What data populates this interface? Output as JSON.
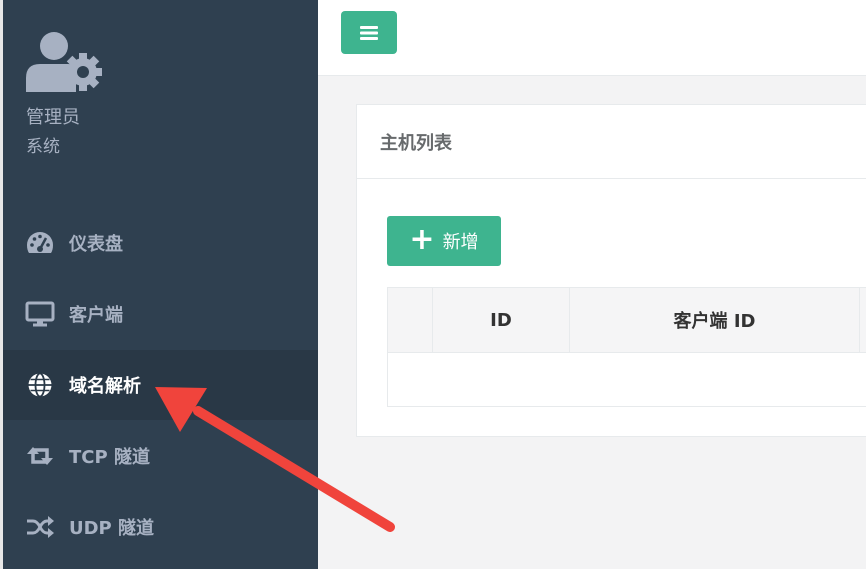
{
  "sidebar": {
    "user": {
      "name": "管理员",
      "role": "系统"
    },
    "items": [
      {
        "label": "仪表盘",
        "icon": "dashboard-icon",
        "active": false
      },
      {
        "label": "客户端",
        "icon": "desktop-icon",
        "active": false
      },
      {
        "label": "域名解析",
        "icon": "globe-icon",
        "active": true
      },
      {
        "label": "TCP 隧道",
        "icon": "retweet-icon",
        "active": false
      },
      {
        "label": "UDP 隧道",
        "icon": "shuffle-icon",
        "active": false
      }
    ]
  },
  "header": {
    "menu_icon": "hamburger-icon"
  },
  "panel": {
    "title": "主机列表",
    "add_label": "新增",
    "columns": [
      "",
      "ID",
      "客户端 ID"
    ]
  },
  "colors": {
    "sidebar_bg": "#2f4050",
    "sidebar_active_bg": "#293846",
    "accent": "#3eb48f",
    "annotation_arrow": "#f0443c"
  }
}
